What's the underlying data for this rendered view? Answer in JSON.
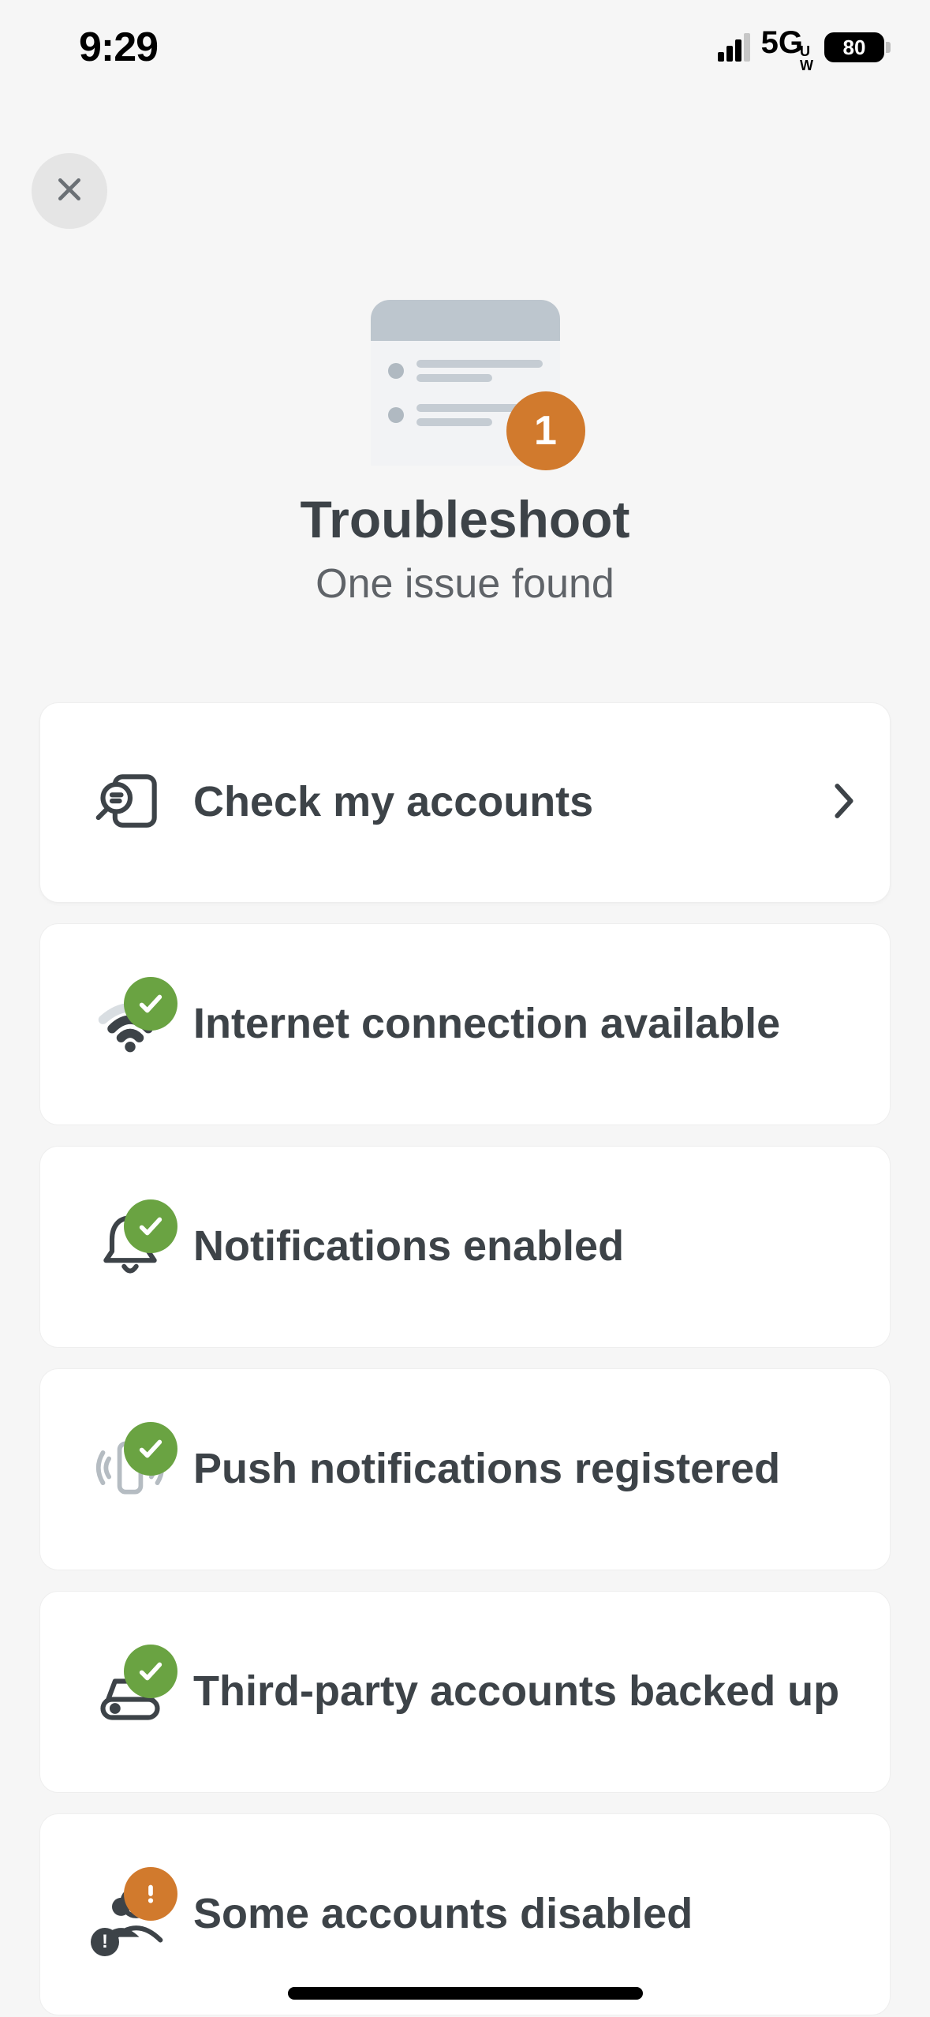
{
  "status_bar": {
    "time": "9:29",
    "network": "5G",
    "network_sub": "UW",
    "battery": "80"
  },
  "hero": {
    "badge": "1",
    "title": "Troubleshoot",
    "subtitle": "One issue found"
  },
  "items": [
    {
      "label": "Check my accounts"
    },
    {
      "label": "Internet connection available"
    },
    {
      "label": "Notifications enabled"
    },
    {
      "label": "Push notifications registered"
    },
    {
      "label": "Third-party accounts backed up"
    },
    {
      "label": "Some accounts disabled"
    }
  ],
  "colors": {
    "accent_orange": "#d17a2d",
    "accent_green": "#6aa342",
    "text_dark": "#3d4348"
  }
}
